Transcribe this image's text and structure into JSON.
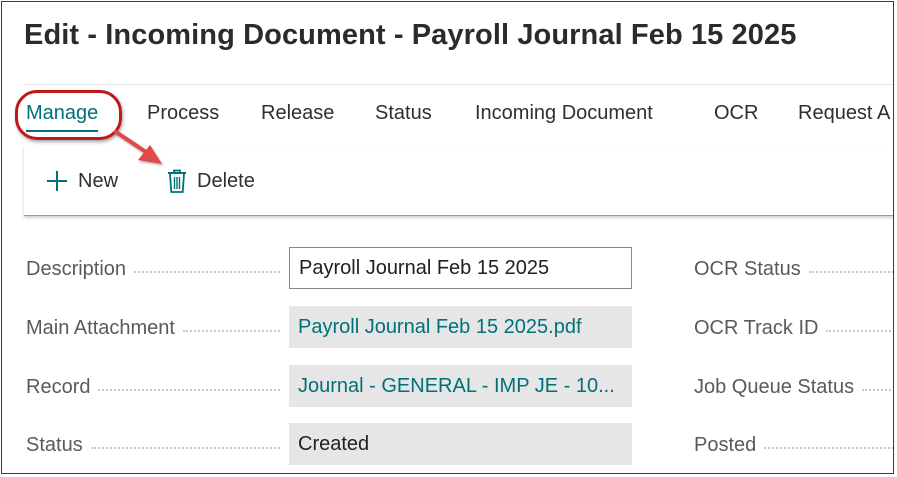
{
  "page": {
    "title": "Edit - Incoming Document - Payroll Journal Feb 15 2025"
  },
  "tabs": [
    {
      "label": "Manage",
      "active": true
    },
    {
      "label": "Process"
    },
    {
      "label": "Release"
    },
    {
      "label": "Status"
    },
    {
      "label": "Incoming Document"
    },
    {
      "label": "OCR"
    },
    {
      "label": "Request A"
    }
  ],
  "actions": {
    "new_label": "New",
    "new_icon": "plus-icon",
    "delete_label": "Delete",
    "delete_icon": "trash-icon"
  },
  "form": {
    "left": [
      {
        "label": "Description",
        "value": "Payroll Journal Feb 15 2025",
        "kind": "input"
      },
      {
        "label": "Main Attachment",
        "value": "Payroll Journal Feb 15 2025.pdf",
        "kind": "link"
      },
      {
        "label": "Record",
        "value": "Journal - GENERAL - IMP JE - 10...",
        "kind": "link"
      },
      {
        "label": "Status",
        "value": "Created",
        "kind": "readonly"
      }
    ],
    "right": [
      {
        "label": "OCR Status"
      },
      {
        "label": "OCR Track ID"
      },
      {
        "label": "Job Queue Status"
      },
      {
        "label": "Posted"
      }
    ]
  },
  "colors": {
    "accent": "#00707a",
    "annotation": "#c01818",
    "readonly_field": "#e6e6e6"
  }
}
